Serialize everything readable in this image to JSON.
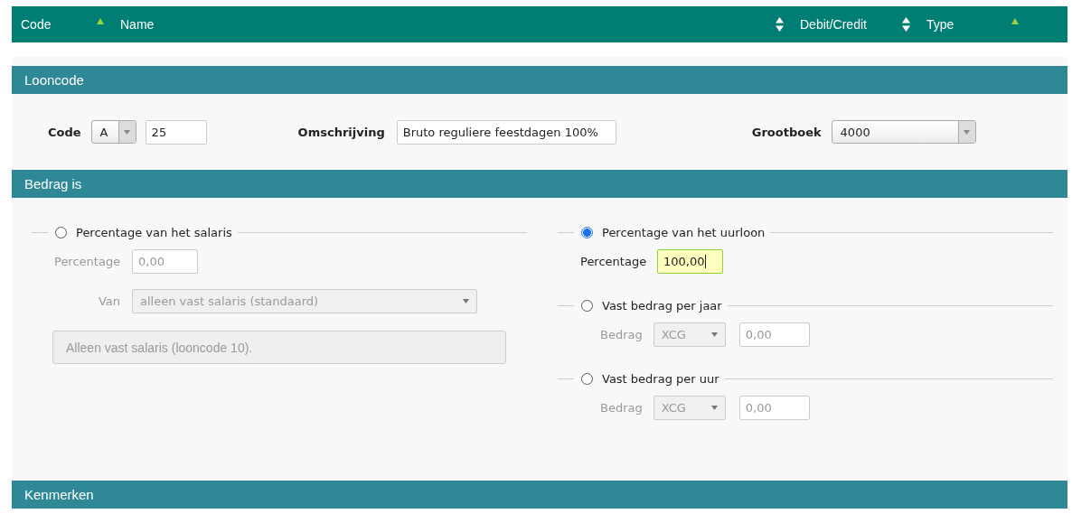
{
  "table_header": {
    "columns": [
      {
        "label": "Code",
        "kind": "sorted"
      },
      {
        "label": "Name",
        "kind": "sortable"
      },
      {
        "label": "Debit/Credit",
        "kind": "sortable"
      },
      {
        "label": "Type",
        "kind": "sorted"
      }
    ]
  },
  "sections": [
    {
      "kind": "looncode",
      "title": "Looncode",
      "code_label": "Code",
      "code_prefix": "A",
      "code_value": "25",
      "description_label": "Omschrijving",
      "description_value": "Bruto reguliere feestdagen 100%",
      "ledger_label": "Grootboek",
      "ledger_value": "4000"
    },
    {
      "kind": "amount",
      "title": "Bedrag is",
      "left": [
        {
          "label": "Percentage van het salaris",
          "selected": false,
          "fields": [
            {
              "kind": "input",
              "label": "Percentage",
              "value": "0,00",
              "focused": false
            },
            {
              "kind": "select",
              "label": "Van",
              "value": "alleen vast salaris (standaard)"
            },
            {
              "kind": "note",
              "text": "Alleen vast salaris (looncode 10)."
            }
          ]
        }
      ],
      "right": [
        {
          "label": "Percentage van het uurloon",
          "selected": true,
          "fields": [
            {
              "kind": "input",
              "label": "Percentage",
              "value": "100,00",
              "focused": true
            }
          ]
        },
        {
          "label": "Vast bedrag per jaar",
          "selected": false,
          "fields": [
            {
              "kind": "currency",
              "label": "Bedrag",
              "currency": "XCG",
              "value": "0,00"
            }
          ]
        },
        {
          "label": "Vast bedrag per uur",
          "selected": false,
          "fields": [
            {
              "kind": "currency",
              "label": "Bedrag",
              "currency": "XCG",
              "value": "0,00"
            }
          ]
        }
      ]
    },
    {
      "kind": "header_only",
      "title": "Kenmerken"
    }
  ]
}
